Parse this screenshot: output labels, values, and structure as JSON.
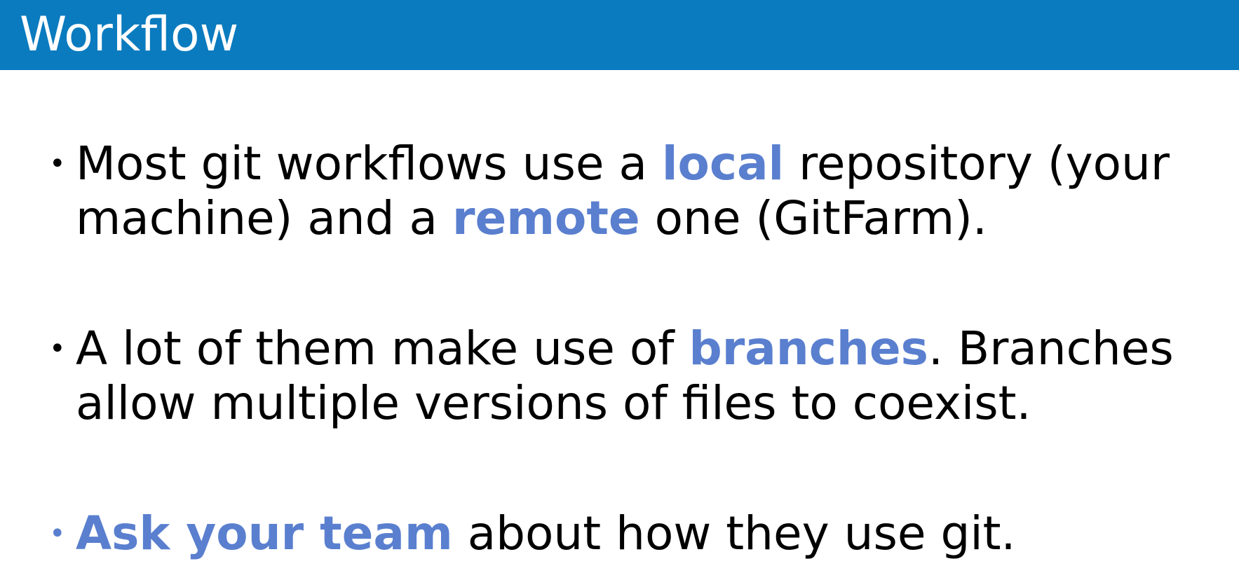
{
  "slide": {
    "title": "Workflow",
    "accent_color": "#5a7fcf",
    "header_color": "#0a7bbf"
  },
  "bullets": [
    {
      "line1_a": "Most git workflows use a ",
      "line1_em": "local",
      "line1_b": " repository (your",
      "line2_a": "machine) and a ",
      "line2_em": "remote",
      "line2_b": " one (GitFarm)."
    },
    {
      "line1_a": "A lot of them make use of ",
      "line1_em": "branches",
      "line1_b": ". Branches",
      "line2": "allow multiple versions of files to coexist."
    },
    {
      "em": "Ask your team",
      "rest": " about how they use git."
    }
  ]
}
